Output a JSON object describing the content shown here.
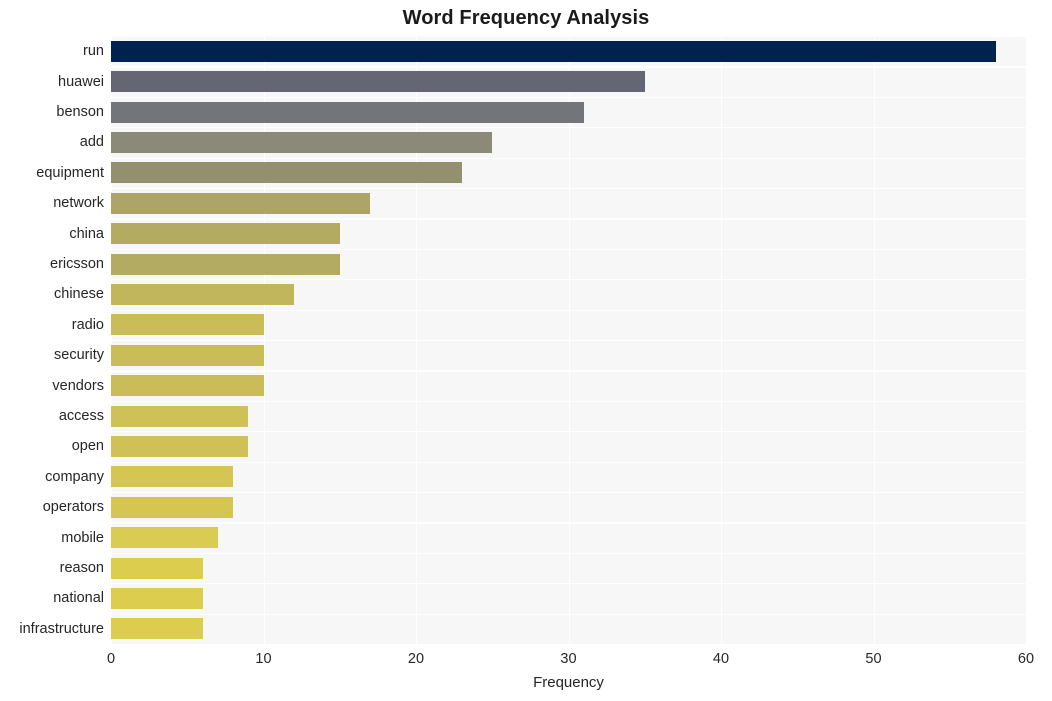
{
  "chart_data": {
    "type": "bar",
    "orientation": "horizontal",
    "title": "Word Frequency Analysis",
    "xlabel": "Frequency",
    "ylabel": "",
    "xlim": [
      0,
      60
    ],
    "ylim": null,
    "xticks": [
      0,
      10,
      20,
      30,
      40,
      50,
      60
    ],
    "xtick_labels": [
      "0",
      "10",
      "20",
      "30",
      "40",
      "50",
      "60"
    ],
    "grid": true,
    "legend": null,
    "categories": [
      "run",
      "huawei",
      "benson",
      "add",
      "equipment",
      "network",
      "china",
      "ericsson",
      "chinese",
      "radio",
      "security",
      "vendors",
      "access",
      "open",
      "company",
      "operators",
      "mobile",
      "reason",
      "national",
      "infrastructure"
    ],
    "values": [
      58,
      35,
      31,
      25,
      23,
      17,
      15,
      15,
      12,
      10,
      10,
      10,
      9,
      9,
      8,
      8,
      7,
      6,
      6,
      6
    ],
    "bar_colors": [
      "#00224e",
      "#656674",
      "#74757a",
      "#8b8978",
      "#93906f",
      "#ada567",
      "#b4ab63",
      "#b4ab63",
      "#c2b65c",
      "#c9bc59",
      "#c9bc59",
      "#c9bc59",
      "#cfc157",
      "#cfc157",
      "#d5c654",
      "#d5c654",
      "#dacb52",
      "#ddcd4f",
      "#ddcd4f",
      "#ddcd4f"
    ],
    "colormap": "cividis",
    "plot_background": "#f7f7f7",
    "grid_color": "#ffffff",
    "figure_background": "#ffffff"
  }
}
